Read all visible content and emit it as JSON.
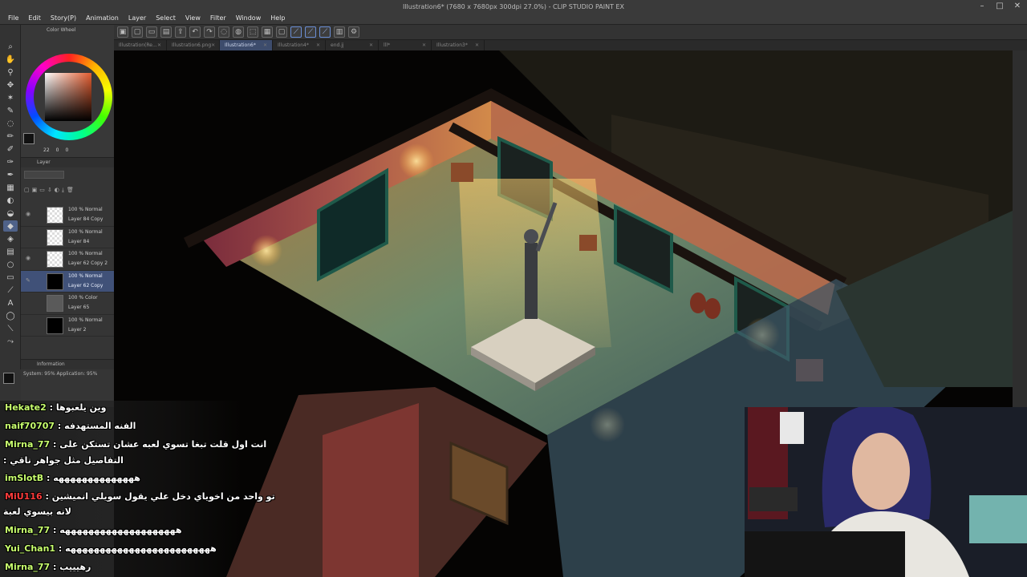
{
  "window": {
    "title": "Illustration6* (7680 x 7680px 300dpi 27.0%) - CLIP STUDIO PAINT EX",
    "controls": [
      "–",
      "□",
      "✕"
    ]
  },
  "menu": [
    "File",
    "Edit",
    "Story(P)",
    "Animation",
    "Layer",
    "Select",
    "View",
    "Filter",
    "Window",
    "Help"
  ],
  "tabs": [
    {
      "label": "Illustration(Re...",
      "active": false
    },
    {
      "label": "Illustration6.png",
      "active": false
    },
    {
      "label": "Illustration6*",
      "active": true
    },
    {
      "label": "Illustration4*",
      "active": false
    },
    {
      "label": "end.jj",
      "active": false
    },
    {
      "label": "lll*",
      "active": false
    },
    {
      "label": "Illustration3*",
      "active": false
    }
  ],
  "color_panel": {
    "title": "Color Wheel",
    "values": [
      "22",
      "0",
      "0"
    ],
    "accent": "#e35c2f"
  },
  "layer_panel": {
    "title": "Layer",
    "layers": [
      {
        "blend": "100 % Normal",
        "name": "Layer 84 Copy",
        "thumb": "checker",
        "selected": false
      },
      {
        "blend": "100 % Normal",
        "name": "Layer 84",
        "thumb": "checker",
        "selected": false
      },
      {
        "blend": "100 % Normal",
        "name": "Layer 62 Copy 2",
        "thumb": "checker",
        "selected": false
      },
      {
        "blend": "100 % Normal",
        "name": "Layer 62 Copy",
        "thumb": "black",
        "selected": true
      },
      {
        "blend": "100 % Color",
        "name": "Layer 65",
        "thumb": "gray",
        "selected": false
      },
      {
        "blend": "100 % Normal",
        "name": "Layer 2",
        "thumb": "black",
        "selected": false
      }
    ]
  },
  "info_panel": {
    "title": "Information",
    "memory": "System: 95% Application: 95%"
  },
  "chat": [
    {
      "user": "Hekate2",
      "sep": " : ",
      "msg": "وين يلعبوها",
      "red": false
    },
    {
      "user": "naif70707",
      "sep": " : ",
      "msg": "الفنه المستهدفه",
      "red": false
    },
    {
      "user": "Mirna_77",
      "sep": " : ",
      "msg": "انت اول قلت تبغا تسوي لعبه عشان تستكن على",
      "red": false
    },
    {
      "user": "",
      "sep": "",
      "msg": ": التفاصيل مثل جواهر ناقي",
      "red": false
    },
    {
      "user": "imSlotB",
      "sep": " : ",
      "msg": "ههههههههههههههه",
      "red": false
    },
    {
      "user": "MiU116",
      "sep": " : ",
      "msg": "تو واحد من اخوياي دخل علي يقول سويلي انميشين",
      "red": true
    },
    {
      "user": "",
      "sep": "",
      "msg": "لانه بيسوي لعبة",
      "red": false
    },
    {
      "user": "Mirna_77",
      "sep": " : ",
      "msg": "ههههههههههههههههههههه",
      "red": false
    },
    {
      "user": "Yui_Chan1",
      "sep": " : ",
      "msg": "هههههههههههههههههههههههههه",
      "red": false
    },
    {
      "user": "Mirna_77",
      "sep": " : ",
      "msg": "رهيييب",
      "red": false
    }
  ]
}
